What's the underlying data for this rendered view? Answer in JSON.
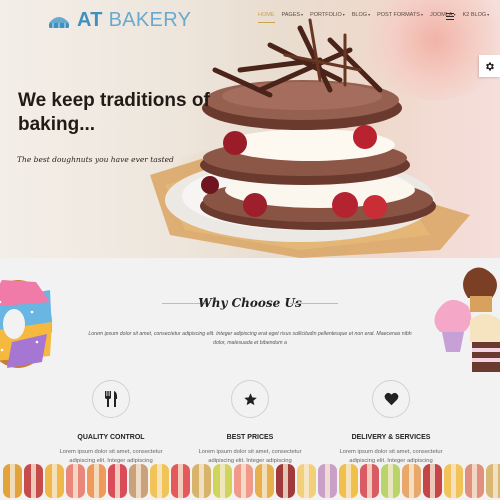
{
  "brand": {
    "name_main": "AT ",
    "name_accent": "BAKERY"
  },
  "nav": {
    "items": [
      {
        "label": "Home",
        "active": true,
        "dropdown": false
      },
      {
        "label": "Pages",
        "active": false,
        "dropdown": true
      },
      {
        "label": "Portfolio",
        "active": false,
        "dropdown": true
      },
      {
        "label": "Blog",
        "active": false,
        "dropdown": true
      },
      {
        "label": "Post Formats",
        "active": false,
        "dropdown": true
      },
      {
        "label": "Joomla",
        "active": false,
        "dropdown": true
      },
      {
        "label": "K2 Blog",
        "active": false,
        "dropdown": true
      }
    ],
    "menu_icon": "hamburger-icon",
    "settings_icon": "gear-icon"
  },
  "hero": {
    "title": "We keep traditions of baking...",
    "subtitle": "The best doughnuts you have ever tasted"
  },
  "why": {
    "title": "Why Choose Us",
    "text": "Lorem ipsum dolor sit amet, consectetur adipiscing elit. Integer adipiscing erat eget risus sollicitudin pellentesque et non erat. Maecenas nibh dolor, malesuada et bibendum a"
  },
  "features": [
    {
      "icon": "utensils-icon",
      "title": "Quality Control",
      "text": "Lorem ipsum dolor sit amet, consectetur adipiscing elit. Integer adipiscing"
    },
    {
      "icon": "star-icon",
      "title": "Best Prices",
      "text": "Lorem ipsum dolor sit amet, consectetur adipiscing elit. Integer adipiscing"
    },
    {
      "icon": "heart-icon",
      "title": "Delivery & Services",
      "text": "Lorem ipsum dolor sit amet, consectetur adipiscing elit. Integer adipiscing"
    }
  ],
  "colors": {
    "brand": "#3f8fbf",
    "nav_active": "#c9a34d",
    "text_dark": "#222222"
  }
}
